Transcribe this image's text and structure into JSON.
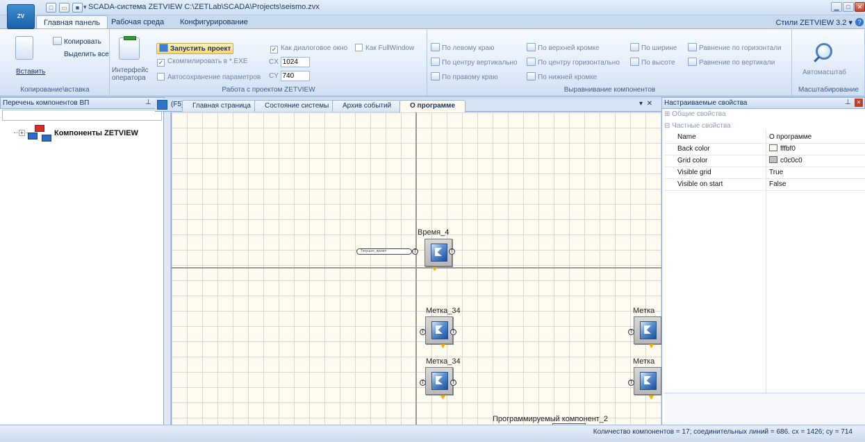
{
  "titlebar": {
    "title": "SCADA-система ZETVIEW C:\\ZETLab\\SCADA\\Projects\\seismo.zvx",
    "app_logo": "ZV"
  },
  "ribbon_tabs": [
    "Главная панель",
    "Рабочая среда",
    "Конфигурирование"
  ],
  "styles_label": "Стили ZETVIEW 3.2",
  "ribbon": {
    "clipboard": {
      "paste": "Вставить",
      "copy": "Копировать",
      "select_all": "Выделить все",
      "group_label": "Копирование\\вставка"
    },
    "project": {
      "interface": "Интерфейс оператора",
      "run": "Запустить проект",
      "compile": "Скомпилировать в *.EXE",
      "autosave": "Автосохранение параметров",
      "dialog": "Как диалоговое окно",
      "fullwindow": "Как FullWindow",
      "cx_label": "CX",
      "cx_value": "1024",
      "cy_label": "CY",
      "cy_value": "740",
      "group_label": "Работа с проектом ZETVIEW"
    },
    "align": {
      "left": "По левому краю",
      "center_v": "По центру вертикально",
      "right": "По правому краю",
      "top": "По верхней кромке",
      "center_h": "По центру горизонтально",
      "bottom": "По нижней кромке",
      "width": "По ширине",
      "height": "По высоте",
      "even_h": "Равнение по горизонтали",
      "even_v": "Равнение по вертикали",
      "group_label": "Выравнивание компонентов"
    },
    "scale": {
      "auto": "Автомасштаб",
      "group_label": "Масштабирование"
    }
  },
  "left_panel": {
    "title": "Перечень компонентов ВП",
    "tree_root": "Компоненты ZETVIEW"
  },
  "doc_tabs": {
    "shortcut": "(F5)",
    "tabs": [
      "Главная страница",
      "Состояние системы",
      "Архив событий",
      "О программе"
    ],
    "active_index": 3
  },
  "canvas": {
    "components": [
      {
        "label": "Время_4"
      },
      {
        "label": "Метка_34"
      },
      {
        "label": "Метка_34"
      },
      {
        "label": "Метка"
      },
      {
        "label": "Метка"
      },
      {
        "label": "Программируемый компонент_2"
      }
    ],
    "time_input_text": "Текущее_время"
  },
  "right_panel": {
    "title": "Настраиваемые свойства",
    "cat_general": "Общие свойства",
    "cat_private": "Частные свойства",
    "props": [
      {
        "name": "Name",
        "value": "О программе"
      },
      {
        "name": "Back color",
        "value": "fffbf0",
        "swatch": "#fffbf0"
      },
      {
        "name": "Grid color",
        "value": "c0c0c0",
        "swatch": "#c0c0c0"
      },
      {
        "name": "Visible grid",
        "value": "True"
      },
      {
        "name": "Visible on start",
        "value": "False"
      }
    ]
  },
  "status": {
    "text": "Количество компонентов = 17; соединительных линий = 686. cx = 1426; cy = 714"
  }
}
